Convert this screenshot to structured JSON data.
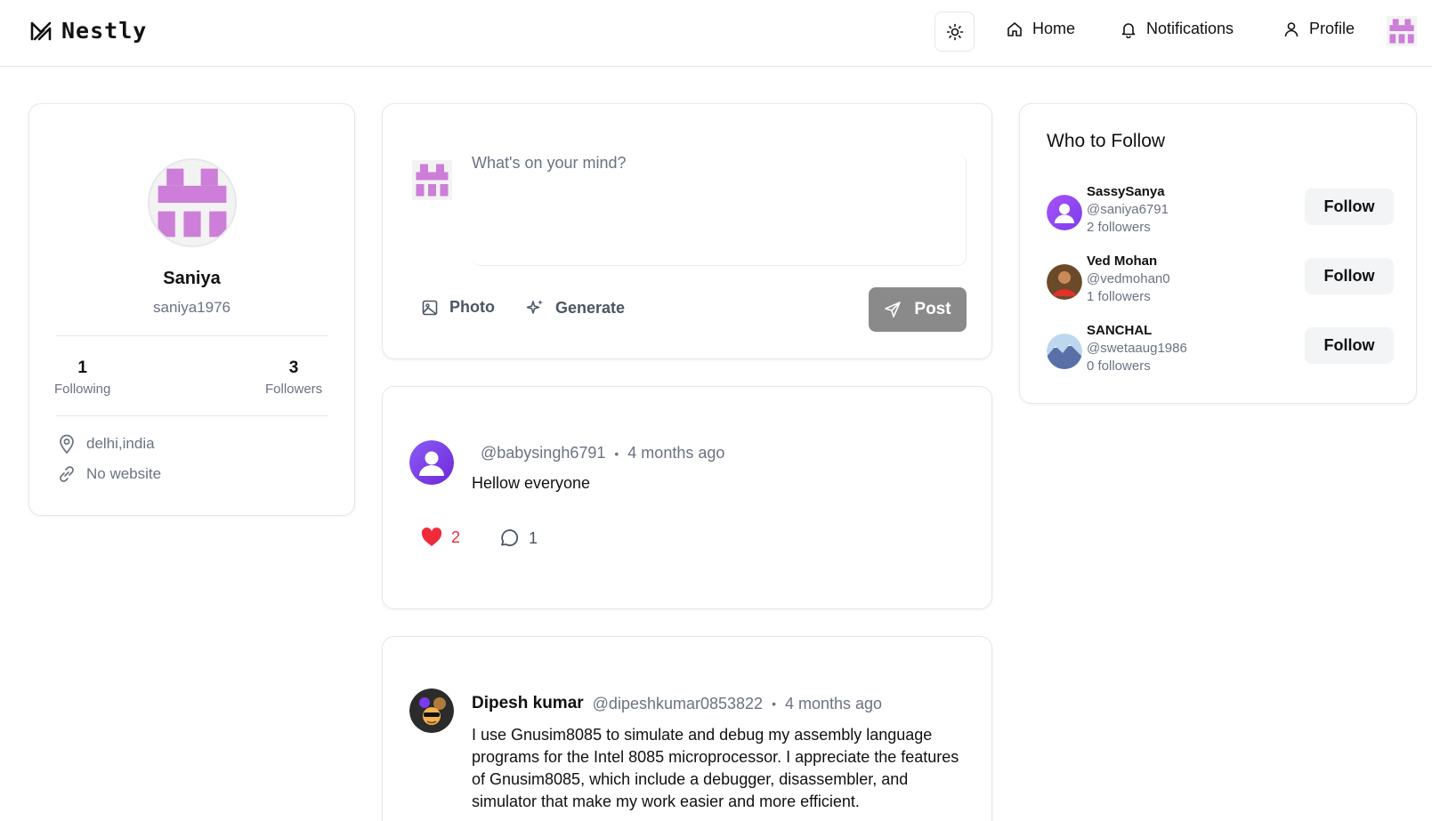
{
  "header": {
    "brand": "Nestly",
    "nav": {
      "home": "Home",
      "notifications": "Notifications",
      "profile": "Profile"
    }
  },
  "profile": {
    "name": "Saniya",
    "handle": "saniya1976",
    "following_count": "1",
    "following_label": "Following",
    "followers_count": "3",
    "followers_label": "Followers",
    "location": "delhi,india",
    "website": "No website"
  },
  "compose": {
    "placeholder": "What's on your mind?",
    "photo_label": "Photo",
    "generate_label": "Generate",
    "post_label": "Post"
  },
  "posts": [
    {
      "author": "",
      "handle": "@babysingh6791",
      "time": "4 months ago",
      "text": "Hellow everyone",
      "likes": "2",
      "comments": "1"
    },
    {
      "author": "Dipesh kumar",
      "handle": "@dipeshkumar0853822",
      "time": "4 months ago",
      "text": "I use Gnusim8085 to simulate and debug my assembly language programs for the Intel 8085 microprocessor. I appreciate the features of Gnusim8085, which include a debugger, disassembler, and simulator that make my work easier and more efficient."
    }
  ],
  "who_to_follow": {
    "title": "Who to Follow",
    "users": [
      {
        "name": "SassySanya",
        "handle": "@saniya6791",
        "followers": "2 followers",
        "button": "Follow"
      },
      {
        "name": "Ved Mohan",
        "handle": "@vedmohan0",
        "followers": "1 followers",
        "button": "Follow"
      },
      {
        "name": "SANCHAL",
        "handle": "@swetaaug1986",
        "followers": "0 followers",
        "button": "Follow"
      }
    ]
  },
  "colors": {
    "accent_purple": "#cc7ed8",
    "like_red": "#ef2b3a",
    "post_button": "#8a8a8a"
  }
}
